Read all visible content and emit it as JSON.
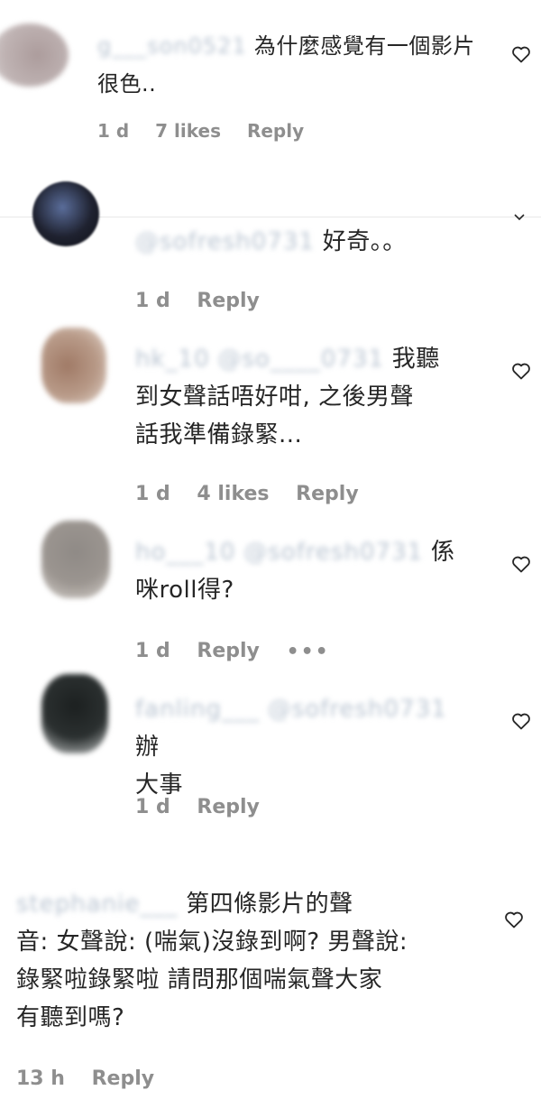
{
  "screenshot_1": {
    "comment": {
      "username": "g___son0521",
      "text_line1": "為什麼感覺有一個影片",
      "text_line2": "很色..",
      "time": "1 d",
      "likes": "7 likes",
      "reply_label": "Reply"
    }
  },
  "screenshot_2": {
    "comments": [
      {
        "mention": "@sofresh0731",
        "text": "好奇。。",
        "time": "1 d",
        "likes": "",
        "reply_label": "Reply"
      },
      {
        "username": "hk_10",
        "mention": "@so____0731",
        "text_line1": "我聽",
        "text_line2": "到女聲話唔好咁, 之後男聲",
        "text_line3": "話我準備錄緊...",
        "time": "1 d",
        "likes": "4 likes",
        "reply_label": "Reply"
      },
      {
        "username": "ho___10",
        "mention": "@sofresh0731",
        "text_line1": "係",
        "text_line2": "咪roll得?",
        "time": "1 d",
        "reply_label": "Reply",
        "more_label": "•••"
      },
      {
        "username": "fanling___",
        "mention": "@sofresh0731",
        "text_line1": "辦",
        "text_line2": "大事",
        "time": "1 d",
        "reply_label": "Reply"
      }
    ]
  },
  "screenshot_3": {
    "comment": {
      "username": "stephanie___",
      "text_line1": "第四條影片的聲",
      "text_line2": "音: 女聲說: (喘氣)沒錄到啊? 男聲說:",
      "text_line3": "錄緊啦錄緊啦 請問那個喘氣聲大家",
      "text_line4": "有聽到嗎?",
      "time": "13 h",
      "reply_label": "Reply"
    }
  },
  "colors": {
    "text": "#262626",
    "meta": "#8e8e8e",
    "blur": "#b9c4d1"
  }
}
